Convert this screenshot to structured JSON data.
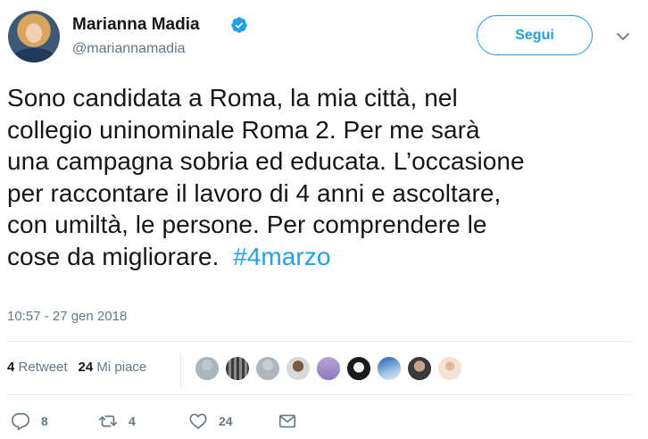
{
  "user": {
    "name": "Marianna Madia",
    "handle": "@mariannamadia"
  },
  "follow_button": {
    "label": "Segui"
  },
  "tweet": {
    "lines": [
      "Sono candidata a Roma, la mia città, nel",
      "collegio uninominale Roma 2.  Per me sarà",
      "una campagna sobria ed educata. L’occasione",
      "per raccontare il lavoro di 4 anni e ascoltare,",
      "con umiltà, le persone. Per comprendere le",
      "cose da migliorare.  "
    ],
    "hashtag": "#4marzo"
  },
  "timestamp": "10:57 - 27 gen 2018",
  "stats": {
    "retweets_count": "4",
    "retweets_label": "Retweet",
    "likes_count": "24",
    "likes_label": "Mi piace"
  },
  "actions": {
    "reply_count": "8",
    "retweet_count": "4",
    "like_count": "24"
  },
  "colors": {
    "accent": "#1da1f2",
    "secondary_text": "#657786",
    "divider": "#e6ecf0"
  },
  "icons": [
    "verified-badge-icon",
    "chevron-down-icon",
    "reply-icon",
    "retweet-icon",
    "heart-icon",
    "envelope-icon"
  ]
}
